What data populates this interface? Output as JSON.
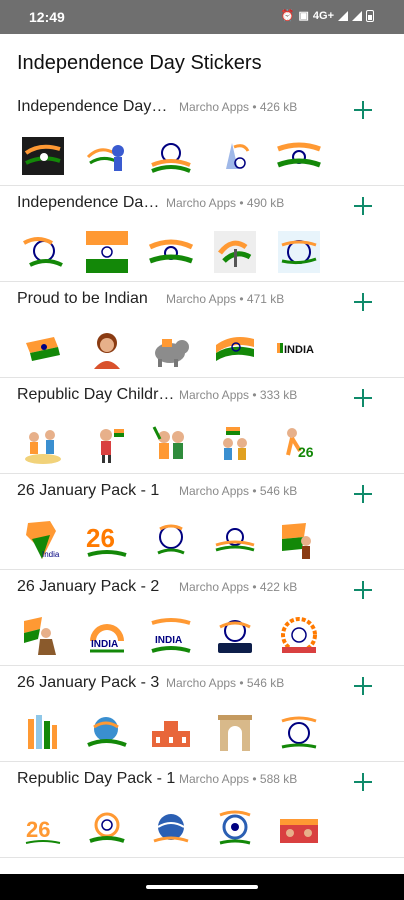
{
  "status": {
    "time": "12:49",
    "net": "4G+"
  },
  "title": "Independence Day Stickers",
  "colors": {
    "accent": "#0f8a6a",
    "saffron": "#ff9933",
    "green": "#138808",
    "navy": "#000080"
  },
  "packs": [
    {
      "name": "Independence Day…",
      "meta": "Marcho Apps • 426 kB"
    },
    {
      "name": "Independence Da…",
      "meta": "Marcho Apps • 490 kB"
    },
    {
      "name": "Proud to be Indian",
      "meta": "Marcho Apps • 471 kB"
    },
    {
      "name": "Republic Day Childr…",
      "meta": "Marcho Apps • 333 kB"
    },
    {
      "name": "26 January Pack - 1",
      "meta": "Marcho Apps • 546 kB"
    },
    {
      "name": "26 January Pack - 2",
      "meta": "Marcho Apps • 422 kB"
    },
    {
      "name": "26 January Pack - 3",
      "meta": "Marcho Apps • 546 kB"
    },
    {
      "name": "Republic Day Pack - 1",
      "meta": "Marcho Apps • 588 kB"
    }
  ],
  "sticker_text": {
    "india": "INDIA",
    "twentysix": "26",
    "small_india": "India"
  }
}
